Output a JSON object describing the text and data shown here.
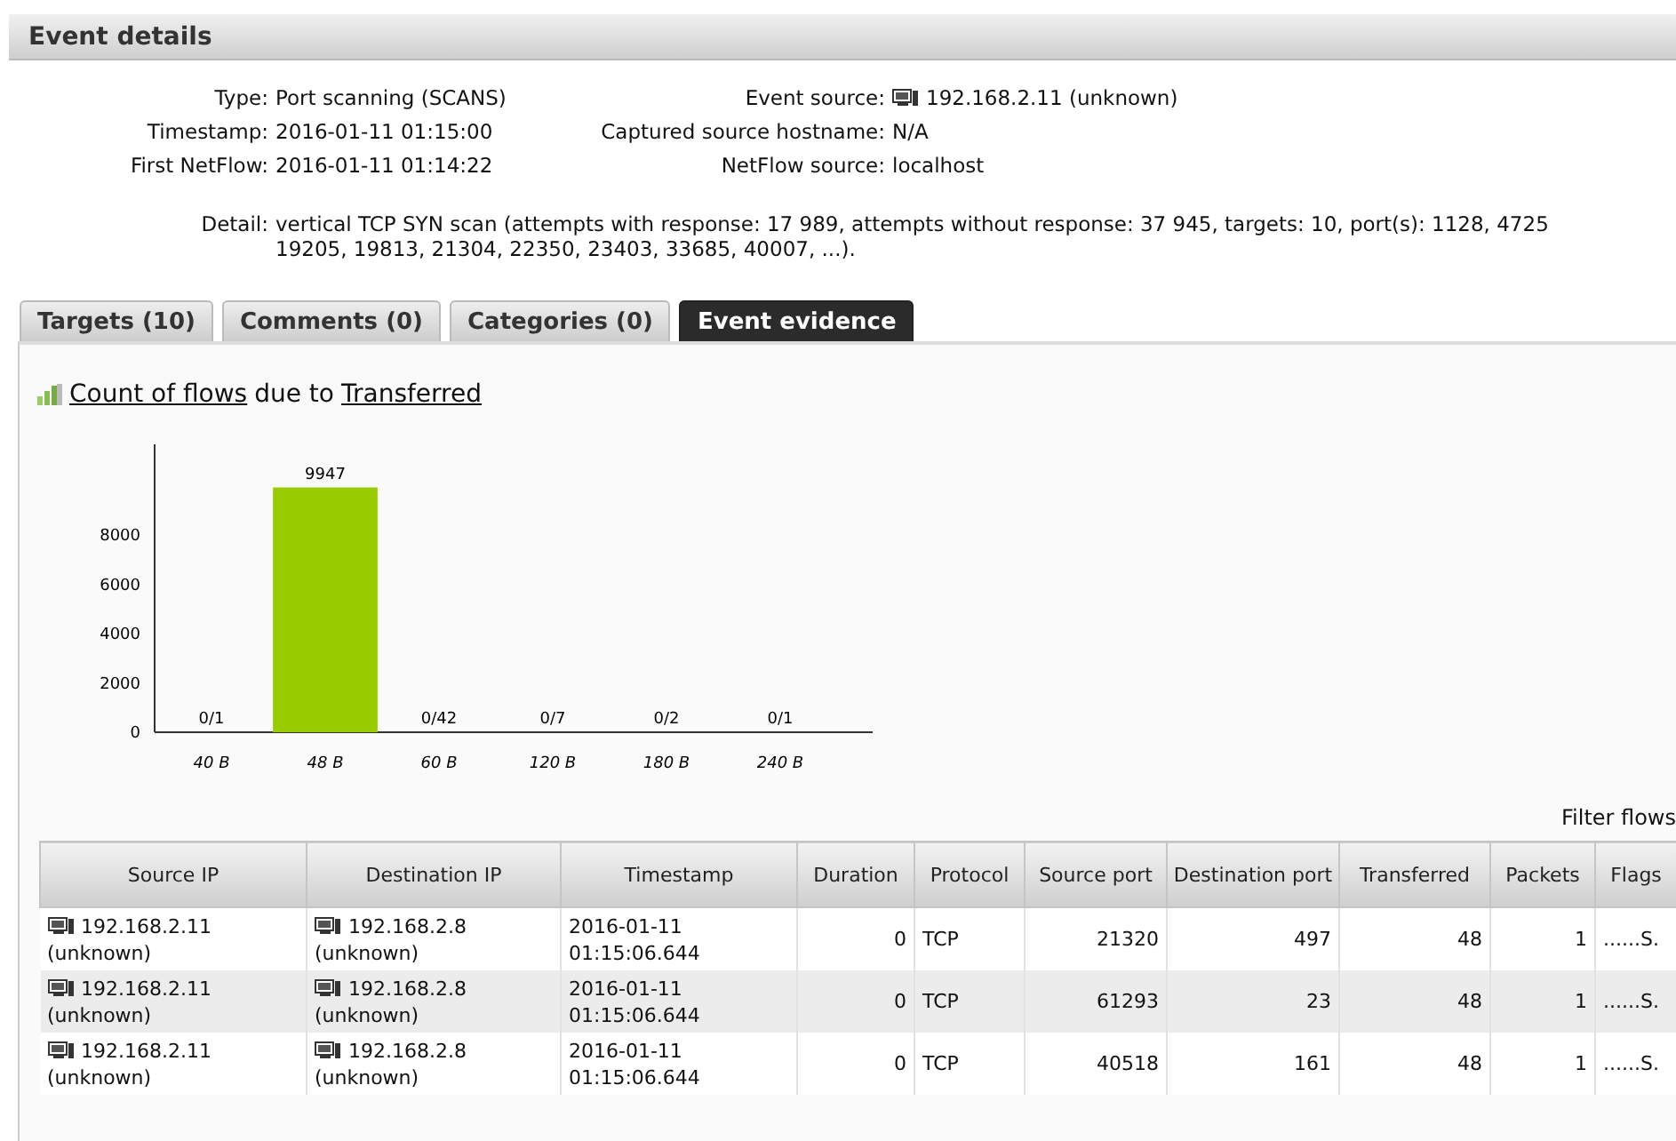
{
  "section": {
    "title": "Event details"
  },
  "details_left": [
    {
      "label": "Type:",
      "value": "Port scanning (SCANS)"
    },
    {
      "label": "Timestamp:",
      "value": "2016-01-11 01:15:00"
    },
    {
      "label": "First NetFlow:",
      "value": "2016-01-11 01:14:22"
    }
  ],
  "details_right": [
    {
      "label": "Event source:",
      "value": "192.168.2.11 (unknown)",
      "kind": "host"
    },
    {
      "label": "Captured source hostname:",
      "value": "N/A",
      "kind": "text"
    },
    {
      "label": "NetFlow source:",
      "value": "localhost",
      "kind": "text"
    }
  ],
  "detail": {
    "label": "Detail:",
    "lines": [
      "vertical TCP SYN scan (attempts with response: 17 989, attempts without response: 37 945, targets: 10, port(s): 1128, 4725",
      "19205, 19813, 21304, 22350, 23403, 33685, 40007, ...)."
    ]
  },
  "tabs": [
    {
      "label": "Targets (10)",
      "selected": false
    },
    {
      "label": "Comments (0)",
      "selected": false
    },
    {
      "label": "Categories (0)",
      "selected": false
    },
    {
      "label": "Event evidence",
      "selected": true
    }
  ],
  "evidence": {
    "title_link_1": "Count of flows",
    "title_middle": "due to",
    "title_link_2": "Transferred",
    "chart_data": {
      "type": "bar",
      "categories": [
        "40 B",
        "48 B",
        "60 B",
        "120 B",
        "180 B",
        "240 B"
      ],
      "values": [
        0,
        9947,
        0,
        0,
        0,
        0
      ],
      "value_labels": [
        "0/1",
        "9947",
        "0/42",
        "0/7",
        "0/2",
        "0/1"
      ],
      "color": "#99cc00",
      "ylim": [
        0,
        11700
      ],
      "yticks": [
        0,
        2000,
        4000,
        6000,
        8000
      ]
    },
    "filter_label": "Filter flows"
  },
  "table": {
    "columns": [
      "Source IP",
      "Destination IP",
      "Timestamp",
      "Duration",
      "Protocol",
      "Source port",
      "Destination port",
      "Transferred",
      "Packets",
      "Flags"
    ],
    "rows": [
      {
        "source_ip": "192.168.2.11",
        "source_name": "(unknown)",
        "dest_ip": "192.168.2.8",
        "dest_name": "(unknown)",
        "date": "2016-01-11",
        "time": "01:15:06.644",
        "duration": "0",
        "protocol": "TCP",
        "source_port": "21320",
        "dest_port": "497",
        "transferred": "48",
        "packets": "1",
        "flags": "......S."
      },
      {
        "source_ip": "192.168.2.11",
        "source_name": "(unknown)",
        "dest_ip": "192.168.2.8",
        "dest_name": "(unknown)",
        "date": "2016-01-11",
        "time": "01:15:06.644",
        "duration": "0",
        "protocol": "TCP",
        "source_port": "61293",
        "dest_port": "23",
        "transferred": "48",
        "packets": "1",
        "flags": "......S."
      },
      {
        "source_ip": "192.168.2.11",
        "source_name": "(unknown)",
        "dest_ip": "192.168.2.8",
        "dest_name": "(unknown)",
        "date": "2016-01-11",
        "time": "01:15:06.644",
        "duration": "0",
        "protocol": "TCP",
        "source_port": "40518",
        "dest_port": "161",
        "transferred": "48",
        "packets": "1",
        "flags": "......S."
      }
    ]
  }
}
